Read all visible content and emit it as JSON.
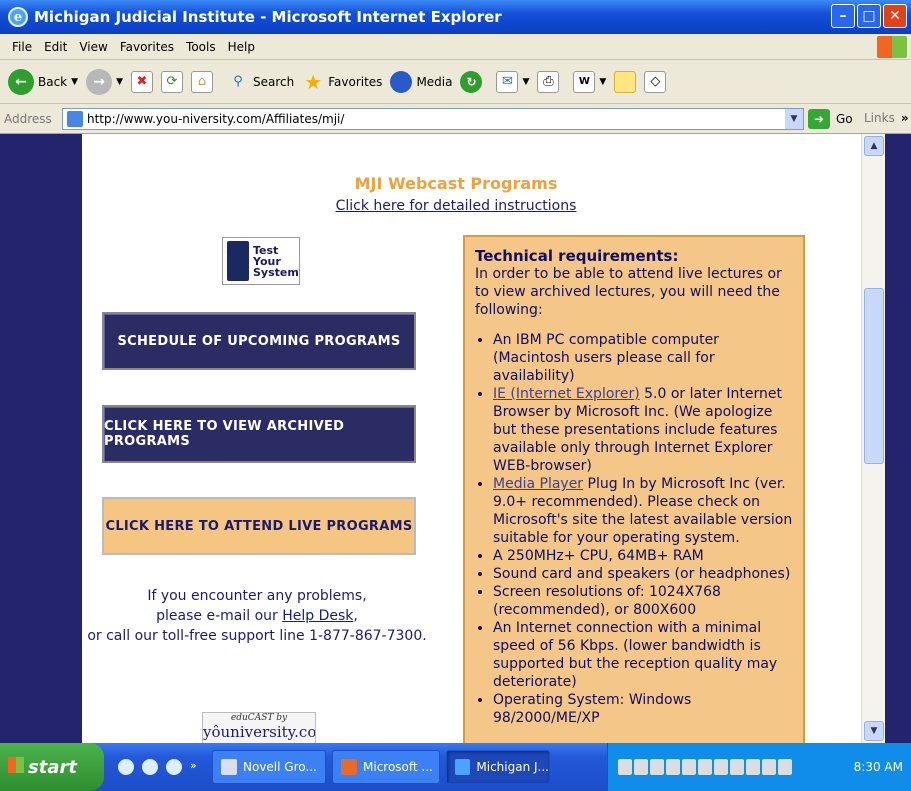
{
  "window": {
    "title": "Michigan Judicial Institute - Microsoft Internet Explorer"
  },
  "menu": [
    "File",
    "Edit",
    "View",
    "Favorites",
    "Tools",
    "Help"
  ],
  "toolbar": {
    "back": "Back",
    "search": "Search",
    "favorites": "Favorites",
    "media": "Media"
  },
  "address": {
    "label": "Address",
    "url": "http://www.you-niversity.com/Affiliates/mji/",
    "go": "Go",
    "links": "Links"
  },
  "page": {
    "heading": "MJI Webcast Programs",
    "instructions_link": "Click here for detailed instructions",
    "test_system_label": [
      "Test",
      "Your",
      "System"
    ],
    "buttons": {
      "schedule": "SCHEDULE OF UPCOMING PROGRAMS",
      "archived": "CLICK HERE TO VIEW ARCHIVED PROGRAMS",
      "live": "CLICK HERE TO ATTEND LIVE PROGRAMS"
    },
    "problems": {
      "line1": "If you encounter any problems,",
      "line2_pre": "please e-mail our ",
      "help_desk": "Help Desk",
      "line2_post": ",",
      "line3": "or call our toll-free support line 1-877-867-7300."
    },
    "educast": {
      "line1": "eduCAST by",
      "line2": "yôuniversity.com"
    },
    "tech": {
      "title": "Technical requirements:",
      "intro": "In order to be able to attend live lectures or to view archived lectures, you will need the following:",
      "item1": "An IBM PC compatible computer (Macintosh users please call for availability)",
      "item2_link": "IE (Internet Explorer)",
      "item2_rest": " 5.0 or later Internet Browser by Microsoft Inc. (We apologize but these presentations include features available only through Internet Explorer WEB-browser)",
      "item3_link": "Media Player",
      "item3_rest": " Plug In by Microsoft Inc (ver. 9.0+ recommended). Please check on Microsoft's site the latest available version suitable for your operating system.",
      "item4": "A 250MHz+ CPU, 64MB+ RAM",
      "item5": "Sound card and speakers (or headphones)",
      "item6": "Screen resolutions of: 1024X768 (recommended), or 800X600",
      "item7": "An Internet connection with a minimal speed of 56 Kbps. (lower bandwidth is supported but the reception quality may deteriorate)",
      "item8": "Operating System: Windows 98/2000/ME/XP"
    }
  },
  "taskbar": {
    "start": "start",
    "tasks": [
      "Novell Gro...",
      "Microsoft ...",
      "Michigan J..."
    ],
    "clock": "8:30 AM"
  }
}
